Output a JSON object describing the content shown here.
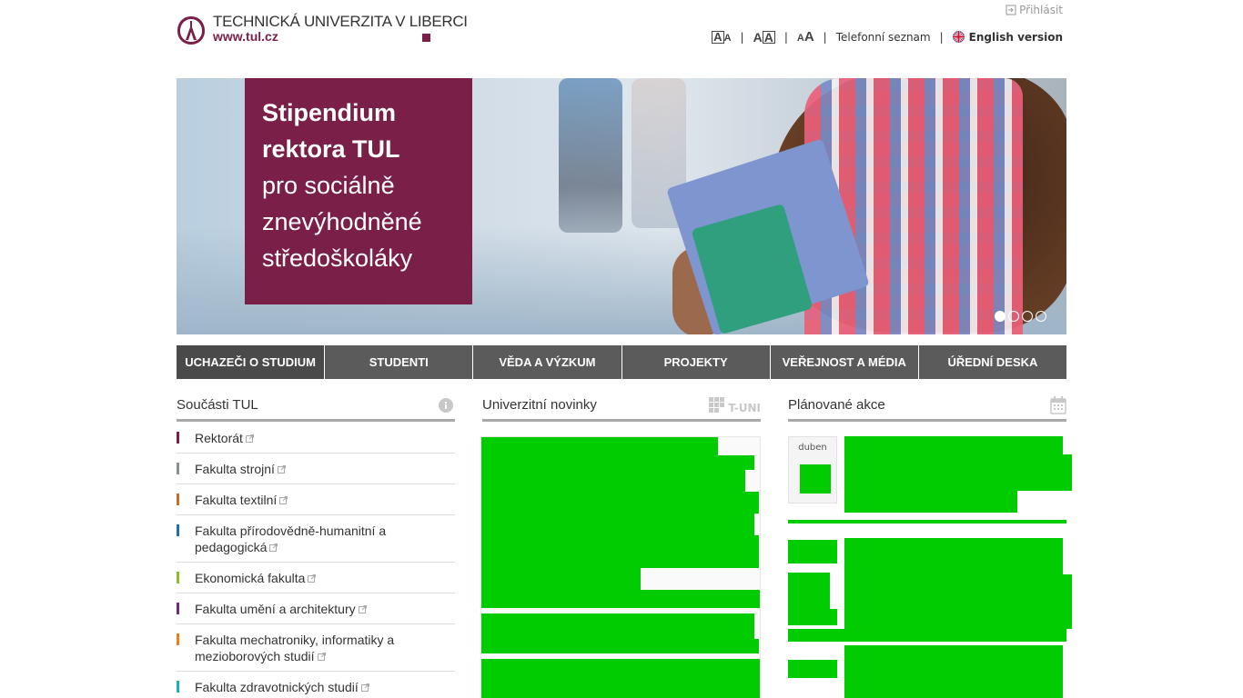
{
  "header": {
    "university_name": "TECHNICKÁ UNIVERZITA V LIBERCI",
    "url": "www.tul.cz",
    "login_label": "Přihlásit",
    "font_size_buttons": [
      "A",
      "A",
      "A"
    ],
    "phone_directory_label": "Telefonní seznam",
    "english_label": "English version"
  },
  "hero": {
    "promo_lines": [
      "Stipendium",
      "rektora TUL",
      "pro sociálně",
      "znevýhodněné",
      "středoškoláky"
    ],
    "slides_count": 4,
    "active_slide": 1
  },
  "nav": {
    "items": [
      "UCHAZEČI O STUDIUM",
      "STUDENTI",
      "VĚDA A VÝZKUM",
      "PROJEKTY",
      "VEŘEJNOST A MÉDIA",
      "ÚŘEDNÍ DESKA"
    ]
  },
  "sections": {
    "units_title": "Součásti TUL",
    "news_title": "Univerzitní novinky",
    "news_badge": "T-UNI",
    "events_title": "Plánované akce"
  },
  "units": [
    {
      "label": "Rektorát",
      "color": "#7a1f48"
    },
    {
      "label": "Fakulta strojní",
      "color": "#8a8f94"
    },
    {
      "label": "Fakulta textilní",
      "color": "#c0702a"
    },
    {
      "label": "Fakulta přírodovědně-humanitní a pedagogická",
      "color": "#1a6fb5"
    },
    {
      "label": "Ekonomická fakulta",
      "color": "#8dbb2e"
    },
    {
      "label": "Fakulta umění a architektury",
      "color": "#6e2a7e"
    },
    {
      "label": "Fakulta mechatroniky, informatiky a mezioborových studií",
      "color": "#ef7d1a"
    },
    {
      "label": "Fakulta zdravotnických studií",
      "color": "#1bb0bf"
    }
  ],
  "events": {
    "first_month": "duben"
  },
  "colors": {
    "brand": "#7a1f48",
    "nav_bg": "#5b5b5b",
    "redaction": "#00cc00"
  }
}
